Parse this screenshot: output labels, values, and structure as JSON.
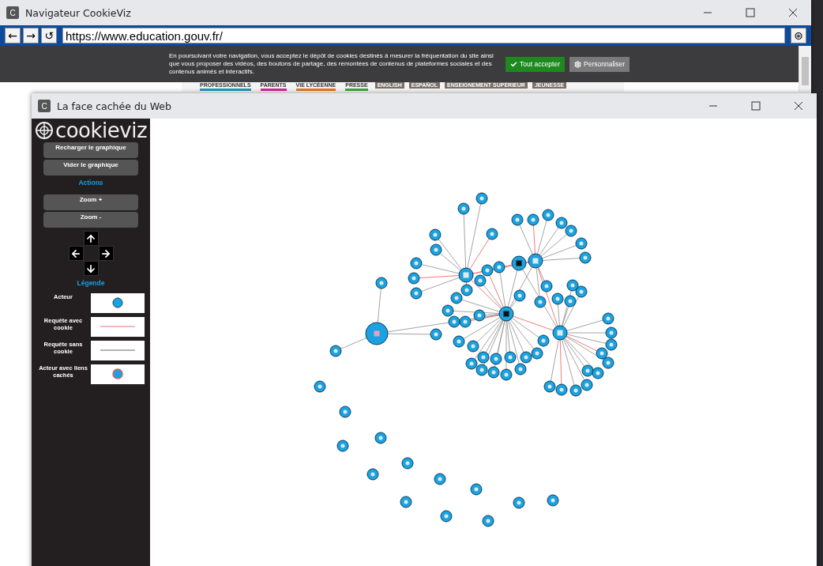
{
  "browser_window": {
    "title": "Navigateur CookieViz",
    "app_badge": "C",
    "nav_buttons": [
      "←",
      "→",
      "↺"
    ],
    "url": "https://www.education.gouv.fr/",
    "go_button": "⊛"
  },
  "cookie_banner": {
    "text": "En poursuivant votre navigation, vous acceptez le dépôt de cookies destinés à mesurer la fréquentation du site ainsi que vous proposer des vidéos, des boutons de partage, des remontées de contenus de plateformes sociales et des contenus animés et interactifs.",
    "accept_button": "Tout accepter",
    "customize_button": "Personnaliser"
  },
  "site_nav": [
    {
      "label": "PROFESSIONNELS",
      "color": "#1a9bbf"
    },
    {
      "label": "PARENTS",
      "color": "#d6249b"
    },
    {
      "label": "VIE LYCÉENNE",
      "color": "#e8741c"
    },
    {
      "label": "PRESSE",
      "color": "#3aa53a"
    },
    {
      "label": "ENGLISH"
    },
    {
      "label": "ESPAÑOL"
    },
    {
      "label": "ENSEIGNEMENT SUPÉRIEUR"
    },
    {
      "label": "JEUNESSE"
    }
  ],
  "viz_window": {
    "title": "La face cachée du Web",
    "app_badge": "C"
  },
  "sidebar": {
    "logo": "cookieviz",
    "buttons": [
      "Recharger le graphique",
      "Vider le graphique"
    ],
    "actions_title": "Actions",
    "zoom_buttons": [
      "Zoom +",
      "Zoom -"
    ],
    "legend_title": "Légende",
    "legend": [
      {
        "label": "Acteur",
        "kind": "node"
      },
      {
        "label": "Requête avec cookie",
        "kind": "cookie-line"
      },
      {
        "label": "Requête sans cookie",
        "kind": "plain-line"
      },
      {
        "label": "Acteur avec liens cachés",
        "kind": "hidden-node"
      }
    ]
  }
}
